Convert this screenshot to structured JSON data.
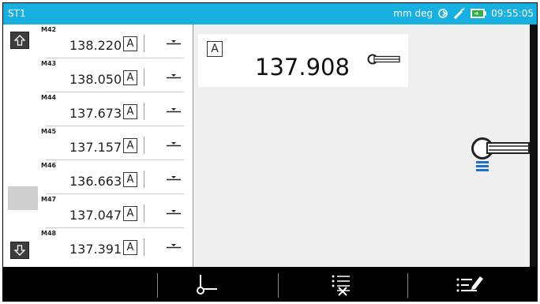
{
  "status_bar": {
    "workstation": "ST1",
    "units": "mm deg",
    "time": "09:55:05"
  },
  "scroll": {
    "up_icon": "arrow-up-icon",
    "down_icon": "arrow-down-icon"
  },
  "measurements": [
    {
      "label": "M42",
      "value": "138.220",
      "mode": "A",
      "feature_icon": "feature-line-icon"
    },
    {
      "label": "M43",
      "value": "138.050",
      "mode": "A",
      "feature_icon": "feature-line-icon"
    },
    {
      "label": "M44",
      "value": "137.673",
      "mode": "A",
      "feature_icon": "feature-line-icon"
    },
    {
      "label": "M45",
      "value": "137.157",
      "mode": "A",
      "feature_icon": "feature-line-icon"
    },
    {
      "label": "M46",
      "value": "136.663",
      "mode": "A",
      "feature_icon": "feature-line-icon"
    },
    {
      "label": "M47",
      "value": "137.047",
      "mode": "A",
      "feature_icon": "feature-line-icon"
    },
    {
      "label": "M48",
      "value": "137.391",
      "mode": "A",
      "feature_icon": "feature-line-icon"
    }
  ],
  "current_reading": {
    "mode": "A",
    "value": "137.908"
  },
  "toolbar": {
    "buttons": [
      "point-probe-icon",
      "delete-list-icon",
      "edit-list-icon"
    ]
  },
  "colors": {
    "status_bar": "#17b0e0",
    "background": "#efefef",
    "bottom_bar": "#000000"
  }
}
